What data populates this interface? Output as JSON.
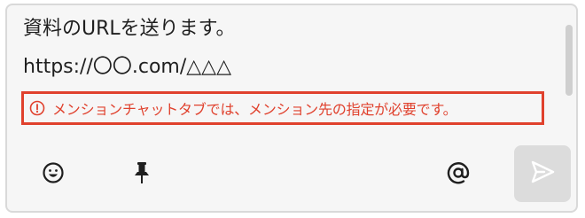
{
  "message": {
    "line1": "資料のURLを送ります。",
    "line2": "https://〇〇.com/△△△"
  },
  "warning": {
    "text": "メンションチャットタブでは、メンション先の指定が必要です。",
    "icon": "info-circle-icon",
    "color": "#e0412d"
  },
  "toolbar": {
    "emoji_icon": "smiley-icon",
    "pin_icon": "pin-icon",
    "mention_icon": "at-sign-icon",
    "send_icon": "send-icon"
  }
}
